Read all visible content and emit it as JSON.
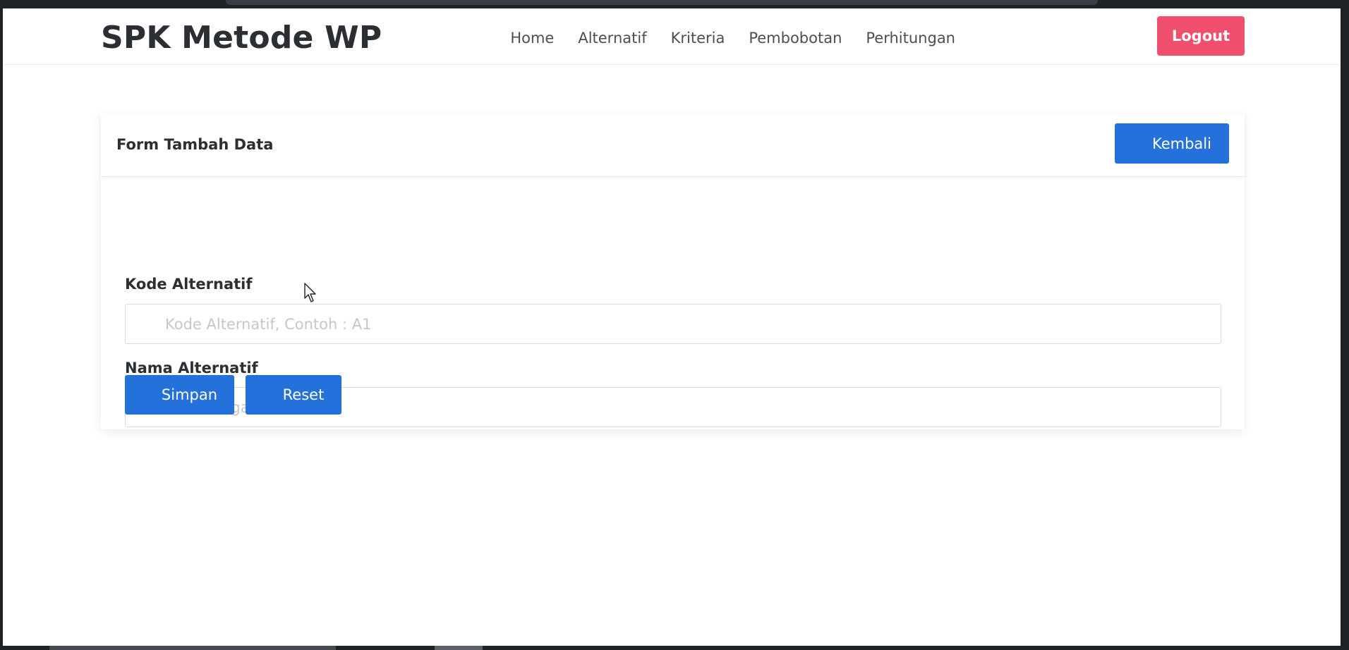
{
  "navbar": {
    "brand": "SPK Metode WP",
    "links": [
      "Home",
      "Alternatif",
      "Kriteria",
      "Pembobotan",
      "Perhitungan"
    ],
    "logout_label": "Logout"
  },
  "card": {
    "title": "Form Tambah Data",
    "back_label": "Kembali"
  },
  "form": {
    "kode": {
      "label": "Kode Alternatif",
      "value": "",
      "placeholder": "Kode Alternatif, Contoh : A1"
    },
    "nama": {
      "label": "Nama Alternatif",
      "value": "",
      "placeholder": "Nama Pegawai",
      "icon": "home-icon"
    },
    "save_label": "Simpan",
    "reset_label": "Reset"
  },
  "colors": {
    "primary": "#2571dc",
    "danger": "#f0506e",
    "text": "#2b2f33"
  }
}
